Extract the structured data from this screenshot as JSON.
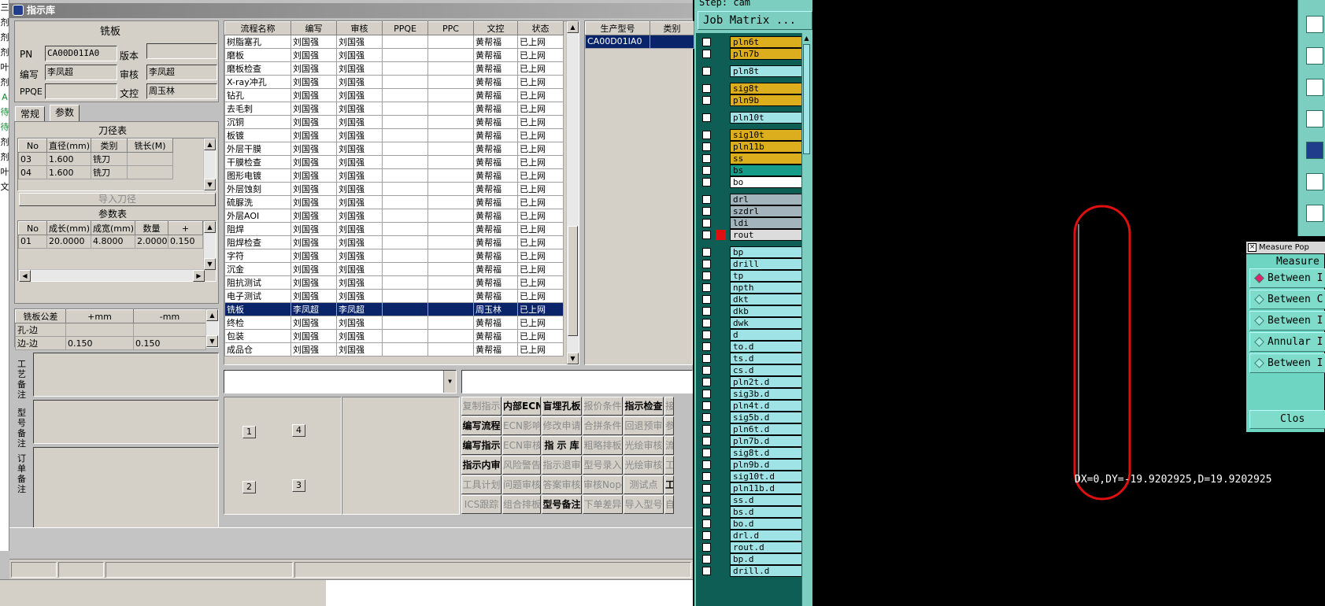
{
  "window_title": "指示库",
  "left_strip": [
    "三",
    "剂",
    "剂",
    "剂",
    "叶",
    "剂",
    "A",
    "待",
    "待",
    "剂",
    "剂",
    "叶",
    "文"
  ],
  "board": {
    "header": "铣板",
    "pn_label": "PN",
    "pn_value": "CA00D01IA0",
    "version_label": "版本",
    "version_value": "",
    "author_label": "编写",
    "author_value": "李凤超",
    "reviewer_label": "审核",
    "reviewer_value": "李凤超",
    "ppqe_label": "PPQE",
    "ppqe_value": "",
    "doc_label": "文控",
    "doc_value": "周玉林"
  },
  "tabs": {
    "normal": "常规",
    "params": "参数"
  },
  "tool_table": {
    "title": "刀径表",
    "columns": [
      "No",
      "直径(mm)",
      "类别",
      "铣长(M)"
    ],
    "rows": [
      [
        "03",
        "1.600",
        "铣刀",
        ""
      ],
      [
        "04",
        "1.600",
        "铣刀",
        ""
      ]
    ]
  },
  "import_tool_button": "导入刀径",
  "param_table": {
    "title": "参数表",
    "columns": [
      "No",
      "成长(mm)",
      "成宽(mm)",
      "数量",
      "+"
    ],
    "rows": [
      [
        "01",
        "20.0000",
        "4.8000",
        "2.0000",
        "0.150"
      ]
    ]
  },
  "tolerance_table": {
    "columns": [
      "铣板公差",
      "+mm",
      "-mm"
    ],
    "rows": [
      [
        "孔-边",
        "",
        ""
      ],
      [
        "边-边",
        "0.150",
        "0.150"
      ]
    ]
  },
  "notes": {
    "tool_note": "工艺备注",
    "model_note": "型号备注",
    "order_note": "订单备注"
  },
  "flow_table": {
    "columns": [
      "流程名称",
      "编写",
      "审核",
      "PPQE",
      "PPC",
      "文控",
      "状态"
    ],
    "rows": [
      [
        "树脂塞孔",
        "刘国强",
        "刘国强",
        "",
        "",
        "黄帮福",
        "已上网"
      ],
      [
        "磨板",
        "刘国强",
        "刘国强",
        "",
        "",
        "黄帮福",
        "已上网"
      ],
      [
        "磨板检查",
        "刘国强",
        "刘国强",
        "",
        "",
        "黄帮福",
        "已上网"
      ],
      [
        "X-ray冲孔",
        "刘国强",
        "刘国强",
        "",
        "",
        "黄帮福",
        "已上网"
      ],
      [
        "钻孔",
        "刘国强",
        "刘国强",
        "",
        "",
        "黄帮福",
        "已上网"
      ],
      [
        "去毛刺",
        "刘国强",
        "刘国强",
        "",
        "",
        "黄帮福",
        "已上网"
      ],
      [
        "沉铜",
        "刘国强",
        "刘国强",
        "",
        "",
        "黄帮福",
        "已上网"
      ],
      [
        "板镀",
        "刘国强",
        "刘国强",
        "",
        "",
        "黄帮福",
        "已上网"
      ],
      [
        "外层干膜",
        "刘国强",
        "刘国强",
        "",
        "",
        "黄帮福",
        "已上网"
      ],
      [
        "干膜检查",
        "刘国强",
        "刘国强",
        "",
        "",
        "黄帮福",
        "已上网"
      ],
      [
        "图形电镀",
        "刘国强",
        "刘国强",
        "",
        "",
        "黄帮福",
        "已上网"
      ],
      [
        "外层蚀刻",
        "刘国强",
        "刘国强",
        "",
        "",
        "黄帮福",
        "已上网"
      ],
      [
        "硫脲洗",
        "刘国强",
        "刘国强",
        "",
        "",
        "黄帮福",
        "已上网"
      ],
      [
        "外层AOI",
        "刘国强",
        "刘国强",
        "",
        "",
        "黄帮福",
        "已上网"
      ],
      [
        "阻焊",
        "刘国强",
        "刘国强",
        "",
        "",
        "黄帮福",
        "已上网"
      ],
      [
        "阻焊检查",
        "刘国强",
        "刘国强",
        "",
        "",
        "黄帮福",
        "已上网"
      ],
      [
        "字符",
        "刘国强",
        "刘国强",
        "",
        "",
        "黄帮福",
        "已上网"
      ],
      [
        "沉金",
        "刘国强",
        "刘国强",
        "",
        "",
        "黄帮福",
        "已上网"
      ],
      [
        "阻抗测试",
        "刘国强",
        "刘国强",
        "",
        "",
        "黄帮福",
        "已上网"
      ],
      [
        "电子测试",
        "刘国强",
        "刘国强",
        "",
        "",
        "黄帮福",
        "已上网"
      ],
      [
        "铣板",
        "李凤超",
        "李凤超",
        "",
        "",
        "周玉林",
        "已上网"
      ],
      [
        "终检",
        "刘国强",
        "刘国强",
        "",
        "",
        "黄帮福",
        "已上网"
      ],
      [
        "包装",
        "刘国强",
        "刘国强",
        "",
        "",
        "黄帮福",
        "已上网"
      ],
      [
        "成品仓",
        "刘国强",
        "刘国强",
        "",
        "",
        "黄帮福",
        "已上网"
      ]
    ],
    "selected_index": 20
  },
  "model_table": {
    "columns": [
      "生产型号",
      "类别"
    ],
    "rows": [
      [
        "CA00D01IA0",
        ""
      ]
    ]
  },
  "number_buttons": [
    "1",
    "4",
    "2",
    "3"
  ],
  "action_buttons": [
    [
      "复制指示",
      "内部ECN",
      "盲埋孔板",
      "报价条件",
      "指示检查",
      "接"
    ],
    [
      "编写流程",
      "ECN影响",
      "修改申请",
      "合拼条件",
      "回退预审",
      "参"
    ],
    [
      "编写指示",
      "ECN审核",
      "指 示 库",
      "粗略排板",
      "光绘审核",
      "流"
    ],
    [
      "指示内审",
      "风险警告",
      "指示退审",
      "型号录入",
      "光绘审核",
      "工"
    ],
    [
      "工具计划",
      "问题审核",
      "答案审核",
      "审核Nope",
      "测试点",
      "工"
    ],
    [
      "ICS跟踪",
      "组合排板",
      "型号备注",
      "下单差异",
      "导入型号",
      "自"
    ]
  ],
  "action_enabled": [
    [
      false,
      true,
      true,
      false,
      true,
      false
    ],
    [
      true,
      false,
      false,
      false,
      false,
      false
    ],
    [
      true,
      false,
      true,
      false,
      false,
      false
    ],
    [
      true,
      false,
      false,
      false,
      false,
      false
    ],
    [
      false,
      false,
      false,
      false,
      false,
      true
    ],
    [
      false,
      false,
      true,
      false,
      false,
      false
    ]
  ],
  "genesis": {
    "step_label": "Step: cam",
    "job_matrix": "Job Matrix ...",
    "layers": [
      {
        "name": "pln6t",
        "color": "sig"
      },
      {
        "name": "pln7b",
        "color": "sig"
      },
      {
        "name": "pln8t",
        "color": "cyan"
      },
      {
        "name": "sig8t",
        "color": "sig"
      },
      {
        "name": "pln9b",
        "color": "sig"
      },
      {
        "name": "pln10t",
        "color": "cyan"
      },
      {
        "name": "sig10t",
        "color": "sig"
      },
      {
        "name": "pln11b",
        "color": "sig"
      },
      {
        "name": "ss",
        "color": "sig"
      },
      {
        "name": "bs",
        "color": "green"
      },
      {
        "name": "bo",
        "color": "white"
      },
      {
        "name": "drl",
        "color": "grey"
      },
      {
        "name": "szdrl",
        "color": "grey"
      },
      {
        "name": "ldi",
        "color": "grey"
      },
      {
        "name": "rout",
        "color": "rout"
      },
      {
        "name": "bp",
        "color": "cyan"
      },
      {
        "name": "drill",
        "color": "cyan"
      },
      {
        "name": "tp",
        "color": "cyan"
      },
      {
        "name": "npth",
        "color": "cyan"
      },
      {
        "name": "dkt",
        "color": "cyan"
      },
      {
        "name": "dkb",
        "color": "cyan"
      },
      {
        "name": "dwk",
        "color": "cyan"
      },
      {
        "name": "d",
        "color": "cyan"
      },
      {
        "name": "to.d",
        "color": "cyan"
      },
      {
        "name": "ts.d",
        "color": "cyan"
      },
      {
        "name": "cs.d",
        "color": "cyan"
      },
      {
        "name": "pln2t.d",
        "color": "cyan"
      },
      {
        "name": "sig3b.d",
        "color": "cyan"
      },
      {
        "name": "pln4t.d",
        "color": "cyan"
      },
      {
        "name": "sig5b.d",
        "color": "cyan"
      },
      {
        "name": "pln6t.d",
        "color": "cyan"
      },
      {
        "name": "pln7b.d",
        "color": "cyan"
      },
      {
        "name": "sig8t.d",
        "color": "cyan"
      },
      {
        "name": "pln9b.d",
        "color": "cyan"
      },
      {
        "name": "sig10t.d",
        "color": "cyan"
      },
      {
        "name": "pln11b.d",
        "color": "cyan"
      },
      {
        "name": "ss.d",
        "color": "cyan"
      },
      {
        "name": "bs.d",
        "color": "cyan"
      },
      {
        "name": "bo.d",
        "color": "cyan"
      },
      {
        "name": "drl.d",
        "color": "cyan"
      },
      {
        "name": "rout.d",
        "color": "cyan"
      },
      {
        "name": "bp.d",
        "color": "cyan"
      },
      {
        "name": "drill.d",
        "color": "cyan"
      }
    ],
    "measure_text": "DX=0,DY=-19.9202925,D=19.9202925",
    "measure_popup": {
      "title": "Measure Pop",
      "header": "Measure",
      "options": [
        "Between I",
        "Between C",
        "Between I",
        "Annular I",
        "Between I"
      ],
      "close": "Clos"
    }
  }
}
